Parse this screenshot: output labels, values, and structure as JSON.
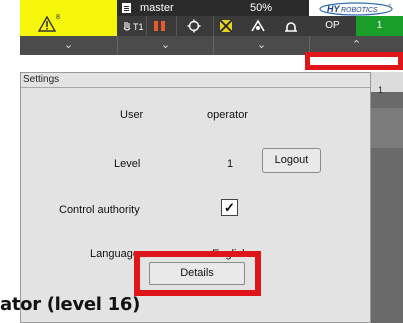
{
  "status_bar": {
    "warning_superscript": "8",
    "program_name": "master",
    "tool_label": "T1",
    "speed": "50%",
    "logo_text": "HYROBOTICS",
    "mode": "OP",
    "step": "1"
  },
  "settings": {
    "title": "Settings",
    "user_label": "User",
    "user_value": "operator",
    "level_label": "Level",
    "level_value": "1",
    "logout_button": "Logout",
    "control_authority_label": "Control authority",
    "control_authority_checked": "✓",
    "language_label": "Language",
    "language_value": "English",
    "details_button": "Details"
  },
  "side_panel": {
    "number": "1"
  },
  "caption": {
    "text": "ator (level 16)"
  },
  "colors": {
    "warning_yellow": "#f6f60a",
    "highlight_red": "#e0151a",
    "step_green": "#1a9e2a"
  }
}
